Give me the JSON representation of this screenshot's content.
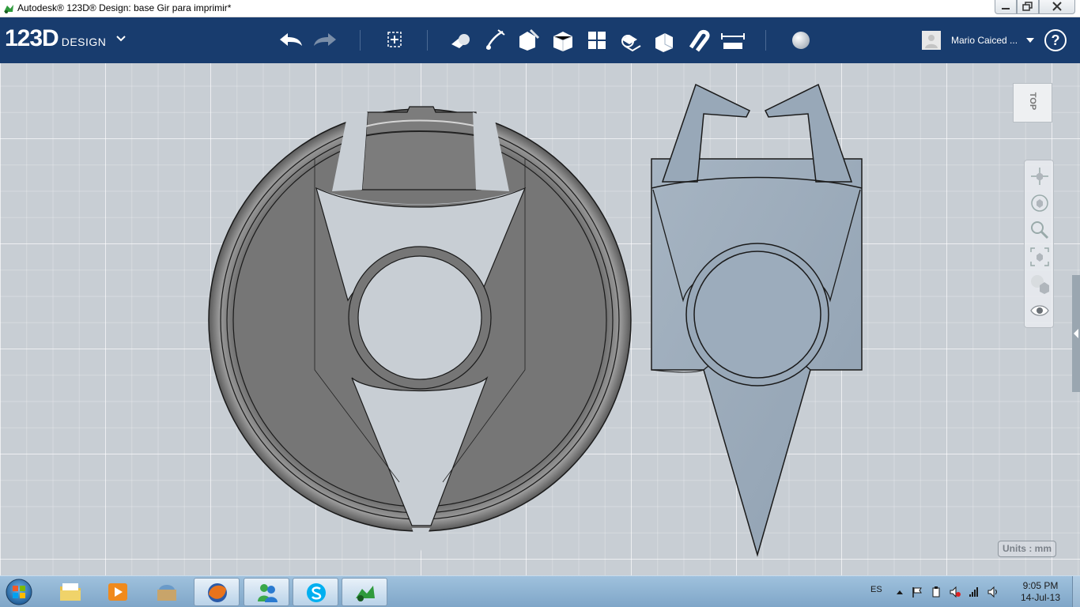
{
  "window": {
    "title": "Autodesk® 123D® Design: base Gir para imprimir*"
  },
  "app": {
    "logo_number": "123D",
    "logo_word": "DESIGN",
    "user_name": "Mario Caiced ...",
    "help_label": "?"
  },
  "toolbar": {
    "items": [
      "undo-icon",
      "redo-icon",
      "transform-icon",
      "primitives-icon",
      "sketch-icon",
      "construct-icon",
      "modify-icon",
      "pattern-icon",
      "grouping-icon",
      "combine-icon",
      "snap-icon",
      "measure-icon",
      "material-icon"
    ]
  },
  "viewport": {
    "viewcube_label": "TOP",
    "units_label": "Units : mm",
    "nav_items": [
      "pan-icon",
      "orbit-icon",
      "zoom-icon",
      "fit-icon",
      "visual-style-icon",
      "visibility-icon"
    ]
  },
  "taskbar": {
    "language": "ES",
    "time": "9:05 PM",
    "date": "14-Jul-13",
    "apps": [
      "explorer-icon",
      "media-player-icon",
      "archive-icon",
      "firefox-icon",
      "messenger-icon",
      "skype-icon",
      "123d-design-icon"
    ]
  },
  "colors": {
    "toolbar_bg": "#183c6e",
    "grid_bg": "#c8ced4",
    "left_part": "#7a7a7a",
    "right_part": "#98a8b8",
    "taskbar_bg": "#8fb3d3"
  }
}
